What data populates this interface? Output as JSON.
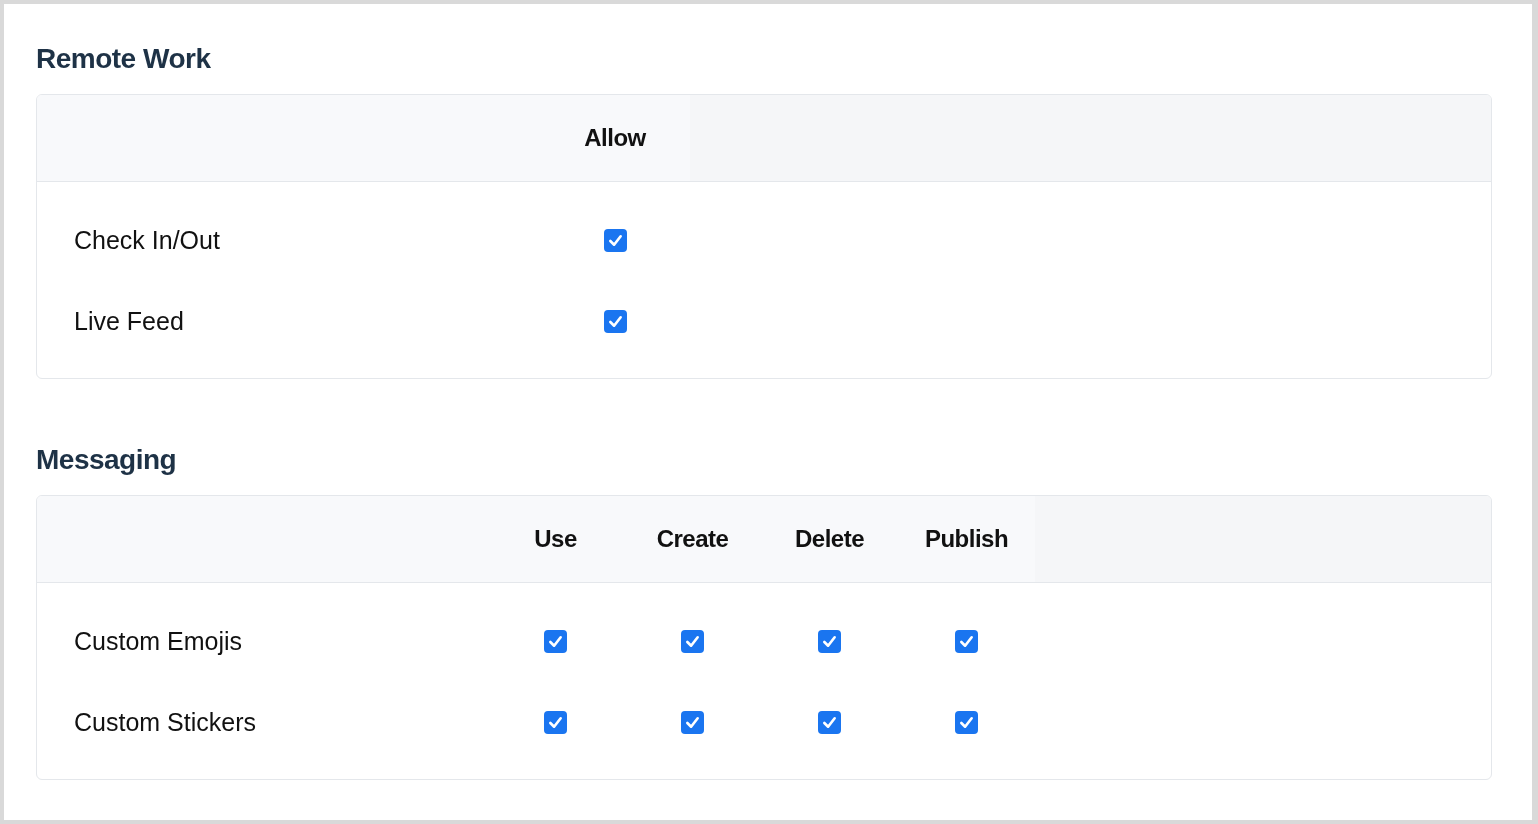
{
  "sections": [
    {
      "title": "Remote Work",
      "columns": [
        "Allow"
      ],
      "rows": [
        {
          "label": "Check In/Out",
          "checks": [
            {
              "checked": true
            }
          ]
        },
        {
          "label": "Live Feed",
          "checks": [
            {
              "checked": true
            }
          ]
        }
      ]
    },
    {
      "title": "Messaging",
      "columns": [
        "Use",
        "Create",
        "Delete",
        "Publish"
      ],
      "rows": [
        {
          "label": "Custom Emojis",
          "checks": [
            {
              "checked": true
            },
            {
              "checked": true
            },
            {
              "checked": true
            },
            {
              "checked": true
            }
          ]
        },
        {
          "label": "Custom Stickers",
          "checks": [
            {
              "checked": true
            },
            {
              "checked": true
            },
            {
              "checked": true
            },
            {
              "checked": true
            }
          ]
        }
      ]
    }
  ]
}
